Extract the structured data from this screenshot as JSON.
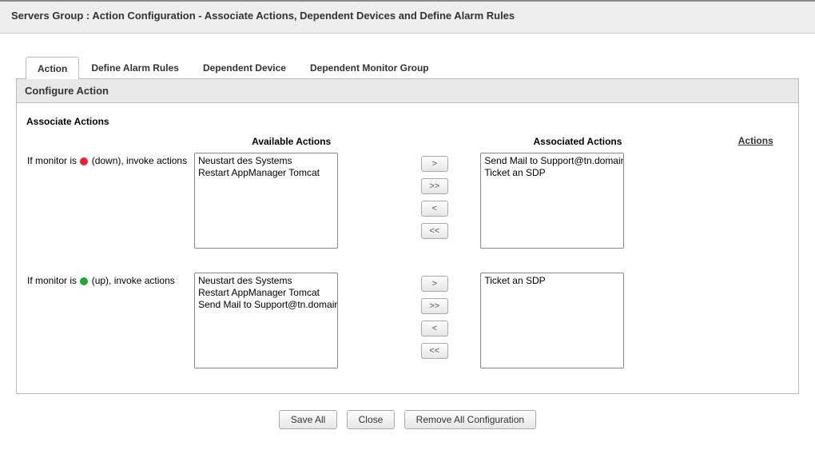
{
  "page_title": "Servers Group : Action Configuration - Associate Actions, Dependent Devices and Define Alarm Rules",
  "tabs": {
    "action": "Action",
    "define_alarm_rules": "Define Alarm Rules",
    "dependent_device": "Dependent Device",
    "dependent_monitor_group": "Dependent Monitor Group"
  },
  "panel_header": "Configure Action",
  "subheader": "Associate Actions",
  "columns": {
    "available": "Available Actions",
    "associated": "Associated Actions"
  },
  "actions_link": "Actions",
  "conditions": {
    "down_pre": "If monitor is ",
    "down_post": " (down), invoke actions",
    "up_pre": "If monitor is ",
    "up_post": " (up), invoke actions"
  },
  "down": {
    "available": [
      "Neustart des Systems",
      "Restart AppManager Tomcat"
    ],
    "associated": [
      "Send Mail to Support@tn.domain",
      "Ticket an SDP"
    ]
  },
  "up": {
    "available": [
      "Neustart des Systems",
      "Restart AppManager Tomcat",
      "Send Mail to Support@tn.domain"
    ],
    "associated": [
      "Ticket an SDP"
    ]
  },
  "move": {
    "add": ">",
    "add_all": ">>",
    "remove": "<",
    "remove_all": "<<"
  },
  "footer": {
    "save_all": "Save All",
    "close": "Close",
    "remove_all": "Remove All Configuration"
  }
}
